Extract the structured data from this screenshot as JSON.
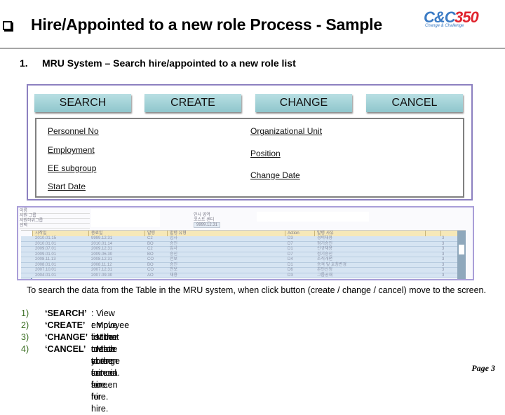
{
  "header": {
    "title": "Hire/Appointed to a new role Process - Sample",
    "logo_part1": "C&C",
    "logo_part2": "350",
    "logo_tagline": "Change & Challenge"
  },
  "section": {
    "number": "1.",
    "heading": "MRU System – Search hire/appointed to a new role list"
  },
  "toolbar": {
    "search_label": "SEARCH",
    "create_label": "CREATE",
    "change_label": "CHANGE",
    "cancel_label": "CANCEL"
  },
  "search_fields": {
    "left": [
      "Personnel No",
      "Employment",
      "EE subgroup",
      "Start Date"
    ],
    "right": [
      "Organizational Unit",
      "Position",
      "Change Date"
    ]
  },
  "sap_screen": {
    "left_labels": [
      "이름",
      "사원 그룹",
      "사원하위그룹",
      "선택"
    ],
    "right_labels": [
      "인사 영역",
      "코스트 센터"
    ],
    "date_value": "9999.12.31",
    "columns": [
      "시작일",
      "종료일",
      "발령",
      "발령 유형",
      "Action",
      "발령 사유",
      "",
      ""
    ],
    "rows": [
      {
        "start": "2010.01.15",
        "end": "9999.12.31",
        "code": "C2",
        "type": "입사",
        "action": "D3",
        "reason": "경력채용",
        "flag": "3"
      },
      {
        "start": "2010.01.01",
        "end": "2010.01.14",
        "code": "BO",
        "type": "승진",
        "action": "D7",
        "reason": "정기승진",
        "flag": "3"
      },
      {
        "start": "2009.07.01",
        "end": "2009.12.31",
        "code": "C2",
        "type": "입사",
        "action": "D1",
        "reason": "신규채용",
        "flag": "3"
      },
      {
        "start": "2009.01.01",
        "end": "2009.06.30",
        "code": "BO",
        "type": "승진",
        "action": "D7",
        "reason": "정기승진",
        "flag": "3"
      },
      {
        "start": "2008.11.13",
        "end": "2008.12.31",
        "code": "CO",
        "type": "전보",
        "action": "D4",
        "reason": "조직개편",
        "flag": "3"
      },
      {
        "start": "2008.01.01",
        "end": "2008.11.12",
        "code": "BO",
        "type": "승진",
        "action": "D1",
        "reason": "승격 및 호칭변경",
        "flag": "3"
      },
      {
        "start": "2007.10.01",
        "end": "2007.12.31",
        "code": "CO",
        "type": "전보",
        "action": "D6",
        "reason": "본인신청",
        "flag": "3"
      },
      {
        "start": "2004.01.01",
        "end": "2007.09.30",
        "code": "AO",
        "type": "채용",
        "action": "D3",
        "reason": "그룹공채",
        "flag": "3"
      }
    ]
  },
  "description": {
    "intro": "To search the data from the   Table in the MRU system, when click button (create / change / cancel) move to the screen.",
    "items": [
      {
        "num": "1)",
        "key": "‘SEARCH’",
        "value": "  : View employee list that match your criteria."
      },
      {
        "num": "2)",
        "key": "‘CREATE’",
        "value": "   :  Move to the create screen for hire."
      },
      {
        "num": "3)",
        "key": "‘CHANGE’",
        "value": " : Move to the change screen for hire."
      },
      {
        "num": "4)",
        "key": "‘CANCEL’",
        "value": "  : Move to the cancel screen for hire."
      }
    ]
  },
  "footer": {
    "page": "Page 3"
  }
}
